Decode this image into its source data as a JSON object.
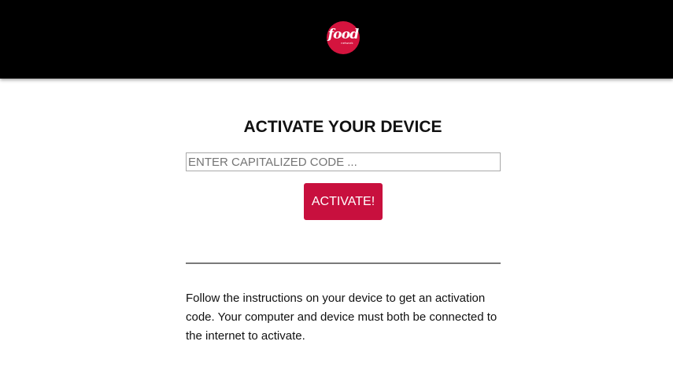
{
  "header": {
    "logo": {
      "word": "food",
      "sub": "network",
      "color": "#d4143e"
    }
  },
  "main": {
    "title": "ACTIVATE YOUR DEVICE",
    "code_input": {
      "placeholder": "ENTER CAPITALIZED CODE ...",
      "value": ""
    },
    "activate_label": "ACTIVATE!",
    "instructions": "Follow the instructions on your device to get an activation code. Your computer and device must both be connected to the internet to activate."
  },
  "colors": {
    "header_bg": "#000000",
    "accent": "#c8103e"
  }
}
